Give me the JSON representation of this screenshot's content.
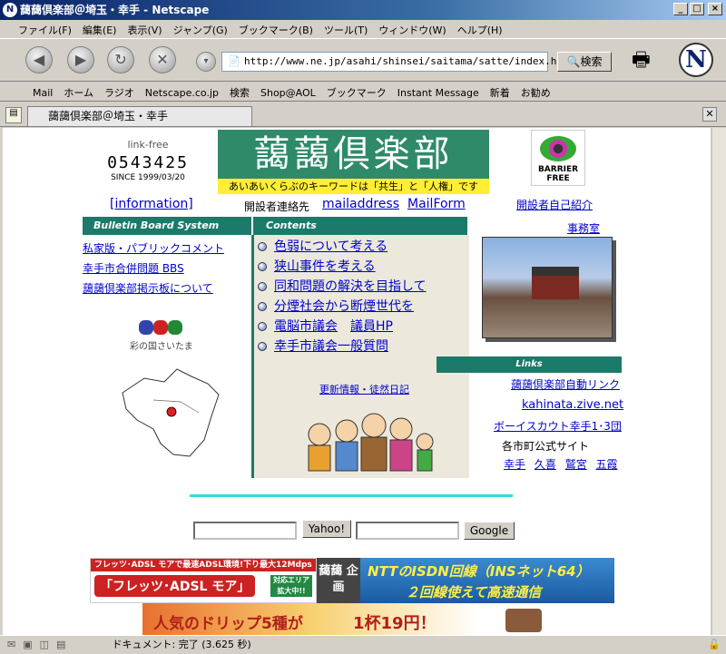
{
  "window": {
    "title": "藹藹倶楽部＠埼玉・幸手 - Netscape",
    "app_icon": "N",
    "buttons": [
      "_",
      "□",
      "×"
    ]
  },
  "menu": [
    "ファイル(F)",
    "編集(E)",
    "表示(V)",
    "ジャンプ(G)",
    "ブックマーク(B)",
    "ツール(T)",
    "ウィンドウ(W)",
    "ヘルプ(H)"
  ],
  "nav": {
    "url": "http://www.ne.jp/asahi/shinsei/saitama/satte/index.htm",
    "search_label": "検索"
  },
  "personal_toolbar": [
    "Mail",
    "ホーム",
    "ラジオ",
    "Netscape.co.jp",
    "検索",
    "Shop@AOL",
    "ブックマーク",
    "Instant Message",
    "新着",
    "お勧め"
  ],
  "tab": {
    "title": "藹藹倶楽部＠埼玉・幸手"
  },
  "page": {
    "counter_label": "link-free",
    "counter": "0543425",
    "since": "SINCE 1999/03/20",
    "banner_title": "藹藹倶楽部",
    "banner_sub": "あいあいくらぶのキーワードは「共生」と「人権」です",
    "barrier_label": "BARRIER FREE",
    "information": "[information]",
    "contact_label": "開設者連絡先",
    "mailaddress": "mailaddress",
    "mailform": "MailForm",
    "self_intro": "開設者自己紹介",
    "office": "事務室",
    "bbs_header": "Bulletin Board System",
    "contents_header": "Contents",
    "bbs_links": [
      "私家版・パブリックコメント",
      "幸手市合併問題 BBS",
      "藹藹倶楽部掲示板について"
    ],
    "saitama_label": "彩の国さいたま",
    "contents": [
      "色弱について考える",
      "狭山事件を考える",
      "同和問題の解決を目指して",
      "分煙社会から断煙世代を",
      "電脳市議会",
      "議員HP",
      "幸手市議会一般質問"
    ],
    "update_link": "更新情報・徒然日記",
    "links_header": "Links",
    "links": [
      "藹藹倶楽部自動リンク",
      "kahinata.zive.net",
      "ボーイスカウト幸手1･3団"
    ],
    "city_label": "各市町公式サイト",
    "cities": [
      "幸手",
      "久喜",
      "鷲宮",
      "五霞"
    ],
    "yahoo_btn": "Yahoo!",
    "google_btn": "Google",
    "ad1_top": "フレッツ･ADSL モアで最速ADSL環境!下り最大12Mdps",
    "ad1_main": "「フレッツ･ADSL モア」",
    "ad1_badge": "対応エリア 拡大中!!",
    "ad_logo": "藹藹 企画",
    "ad2_line1": "NTTのISDN回線（INSネット64）",
    "ad2_line2": "２回線使えて高速通信",
    "ad3_text": "人気のドリップ5種が",
    "ad3_price": "1杯19円！"
  },
  "status": {
    "text": "ドキュメント: 完了 (3.625 秒)"
  },
  "colors": {
    "title_start": "#0a246a",
    "banner": "#2f8a6a",
    "section": "#1c7a6a",
    "link": "#0000cc",
    "contents_bg": "#ece9dc"
  }
}
